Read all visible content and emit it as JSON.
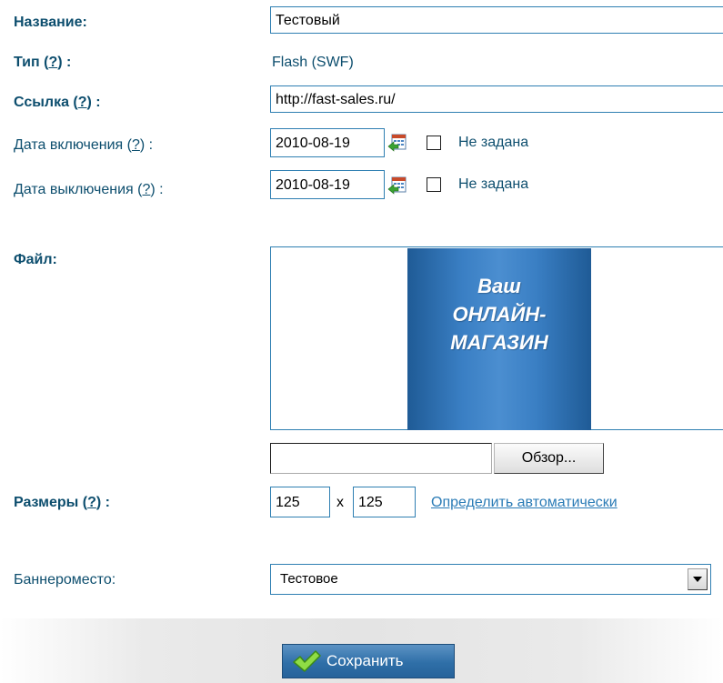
{
  "fields": {
    "name": {
      "label": "Название:",
      "value": "Тестовый"
    },
    "type": {
      "label_prefix": "Тип (",
      "help": "?",
      "label_suffix": ") :",
      "value": "Flash (SWF)"
    },
    "link": {
      "label_prefix": "Ссылка (",
      "help": "?",
      "label_suffix": ") :",
      "value": "http://fast-sales.ru/"
    },
    "date_on": {
      "label_prefix": "Дата включения (",
      "help": "?",
      "label_suffix": ") :",
      "value": "2010-08-19",
      "not_set": "Не задана",
      "checked": false
    },
    "date_off": {
      "label_prefix": "Дата выключения (",
      "help": "?",
      "label_suffix": ") :",
      "value": "2010-08-19",
      "not_set": "Не задана",
      "checked": false
    }
  },
  "file": {
    "label": "Файл:",
    "preview_text": [
      "Ваш",
      "ОНЛАЙН-",
      "МАГАЗИН"
    ],
    "browse_label": "Обзор...",
    "path_value": ""
  },
  "sizes": {
    "label_prefix": "Размеры (",
    "help": "?",
    "label_suffix": ") :",
    "width": "125",
    "separator": "x",
    "height": "125",
    "auto_link": "Определить автоматически"
  },
  "placement": {
    "label": "Баннероместо:",
    "selected": "Тестовое"
  },
  "actions": {
    "save_label": "Сохранить"
  },
  "colors": {
    "label": "#0d4e6e",
    "border": "#2f7fb2",
    "link": "#2a7bb6",
    "banner": "#3a7fc4"
  }
}
